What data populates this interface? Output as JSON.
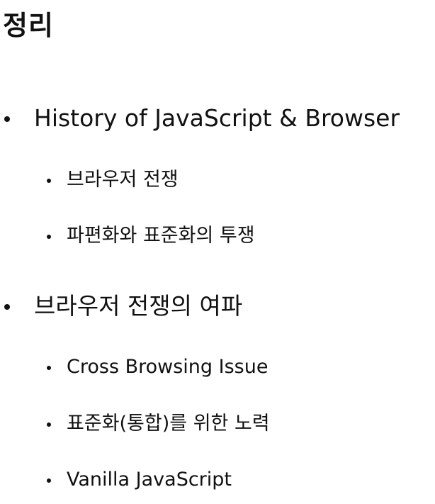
{
  "title": "정리",
  "sections": [
    {
      "heading": "History of JavaScript & Browser",
      "items": [
        "브라우저 전쟁",
        "파편화와 표준화의 투쟁"
      ]
    },
    {
      "heading": "브라우저 전쟁의 여파",
      "items": [
        "Cross Browsing Issue",
        "표준화(통합)를 위한 노력",
        "Vanilla JavaScript"
      ]
    }
  ]
}
